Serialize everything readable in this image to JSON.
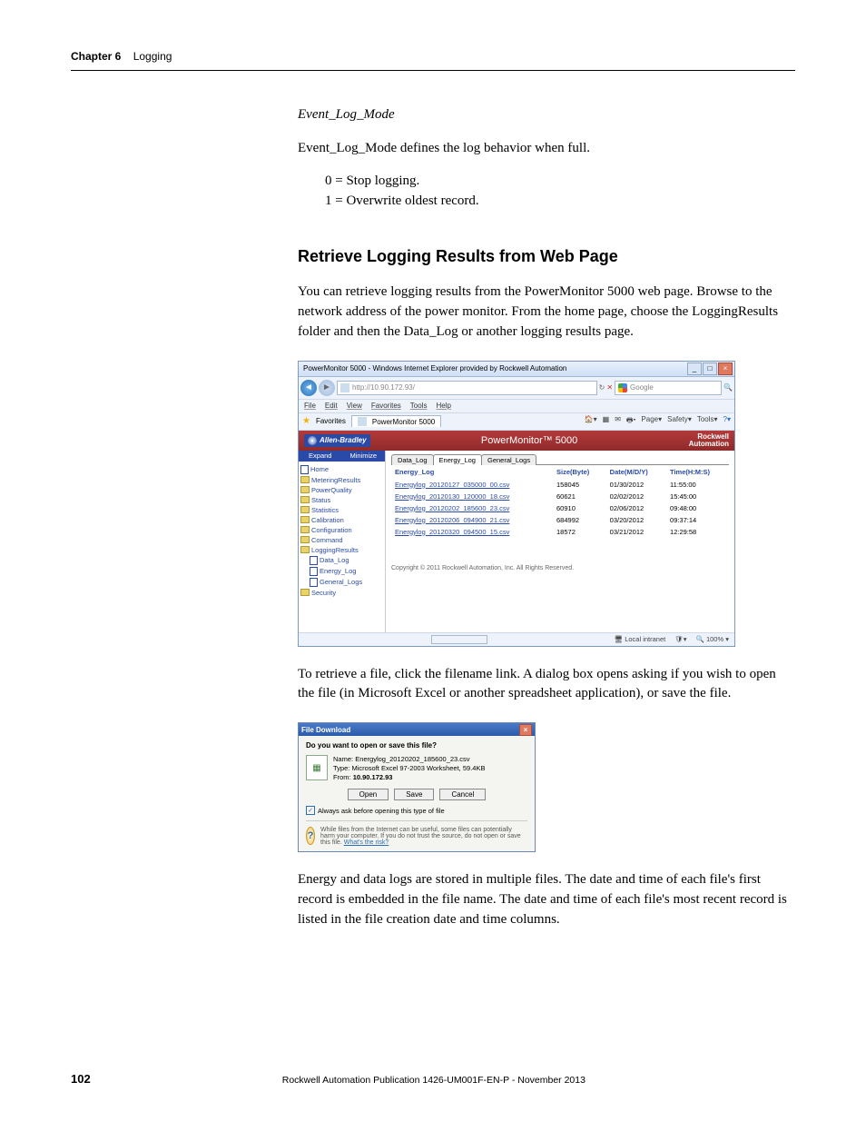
{
  "running_head": {
    "chapter": "Chapter 6",
    "title": "Logging"
  },
  "section1": {
    "heading": "Event_Log_Mode",
    "p1": "Event_Log_Mode defines the log behavior when full.",
    "opt0": "0 = Stop logging.",
    "opt1": "1 = Overwrite oldest record."
  },
  "section2": {
    "heading": "Retrieve Logging Results from Web Page",
    "p1": "You can retrieve logging results from the PowerMonitor 5000 web page. Browse to the network address of the power monitor. From the home page, choose the LoggingResults folder and then the Data_Log or another logging results page."
  },
  "browser": {
    "title": "PowerMonitor 5000 - Windows Internet Explorer provided by Rockwell Automation",
    "url": "http://10.90.172.93/",
    "search_provider": "Google",
    "menus": [
      "File",
      "Edit",
      "View",
      "Favorites",
      "Tools",
      "Help"
    ],
    "fav_label": "Favorites",
    "tab_label": "PowerMonitor 5000",
    "tools": [
      "Page",
      "Safety",
      "Tools"
    ],
    "brand_left": "Allen-Bradley",
    "product_title": "PowerMonitor™ 5000",
    "brand_right1": "Rockwell",
    "brand_right2": "Automation",
    "side_expand": "Expand",
    "side_minimize": "Minimize",
    "tree": {
      "home": "Home",
      "items": [
        "MeteringResults",
        "PowerQuality",
        "Status",
        "Statistics",
        "Calibration",
        "Configuration",
        "Command",
        "LoggingResults"
      ],
      "logging_children": [
        "Data_Log",
        "Energy_Log",
        "General_Logs"
      ],
      "security": "Security"
    },
    "tabs": [
      "Data_Log",
      "Energy_Log",
      "General_Logs"
    ],
    "active_tab_index": 1,
    "table_headers": [
      "Energy_Log",
      "Size(Byte)",
      "Date(M/D/Y)",
      "Time(H:M:S)"
    ],
    "rows": [
      {
        "file": "Energylog_20120127_035000_00.csv",
        "size": "158045",
        "date": "01/30/2012",
        "time": "11:55:00"
      },
      {
        "file": "Energylog_20120130_120000_18.csv",
        "size": "60621",
        "date": "02/02/2012",
        "time": "15:45:00"
      },
      {
        "file": "Energylog_20120202_185600_23.csv",
        "size": "60910",
        "date": "02/06/2012",
        "time": "09:48:00"
      },
      {
        "file": "Energylog_20120206_094900_21.csv",
        "size": "684992",
        "date": "03/20/2012",
        "time": "09:37:14"
      },
      {
        "file": "Energylog_20120320_094500_15.csv",
        "size": "18572",
        "date": "03/21/2012",
        "time": "12:29:58"
      }
    ],
    "copyright": "Copyright © 2011 Rockwell Automation, Inc. All Rights Reserved.",
    "status_zone": "Local intranet",
    "status_zoom": "100%"
  },
  "p_after_browser": "To retrieve a file, click the filename link. A dialog box opens asking if you wish to open the file (in Microsoft Excel or another spreadsheet application), or save the file.",
  "dialog": {
    "title": "File Download",
    "question": "Do you want to open or save this file?",
    "name_lbl": "Name:",
    "name_val": "Energylog_20120202_185600_23.csv",
    "type_lbl": "Type:",
    "type_val": "Microsoft Excel 97-2003 Worksheet, 59.4KB",
    "from_lbl": "From:",
    "from_val": "10.90.172.93",
    "btn_open": "Open",
    "btn_save": "Save",
    "btn_cancel": "Cancel",
    "always_ask": "Always ask before opening this type of file",
    "warning": "While files from the Internet can be useful, some files can potentially harm your computer. If you do not trust the source, do not open or save this file.",
    "risk_link": "What's the risk?"
  },
  "p_last": "Energy and data logs are stored in multiple files. The date and time of each file's first record is embedded in the file name. The date and time of each file's most recent record is listed in the file creation date and time columns.",
  "footer": {
    "page": "102",
    "pub": "Rockwell Automation Publication 1426-UM001F-EN-P - November 2013"
  }
}
